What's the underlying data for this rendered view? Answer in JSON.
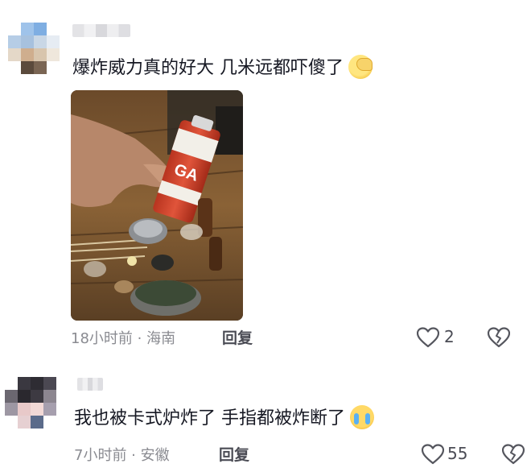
{
  "comments": [
    {
      "text": "爆炸威力真的好大  几米远都吓傻了",
      "emoji": "facepalm-emoji",
      "time": "18小时前",
      "location": "海南",
      "reply_label": "回复",
      "likes": "2",
      "has_image": true
    },
    {
      "text": "我也被卡式炉炸了  手指都被炸断了",
      "emoji": "crying-emoji",
      "time": "7小时前",
      "location": "安徽",
      "reply_label": "回复",
      "likes": "55",
      "has_image": false
    }
  ],
  "colors": {
    "text": "#161823",
    "meta": "#8a8b91",
    "icon": "#55565e"
  }
}
